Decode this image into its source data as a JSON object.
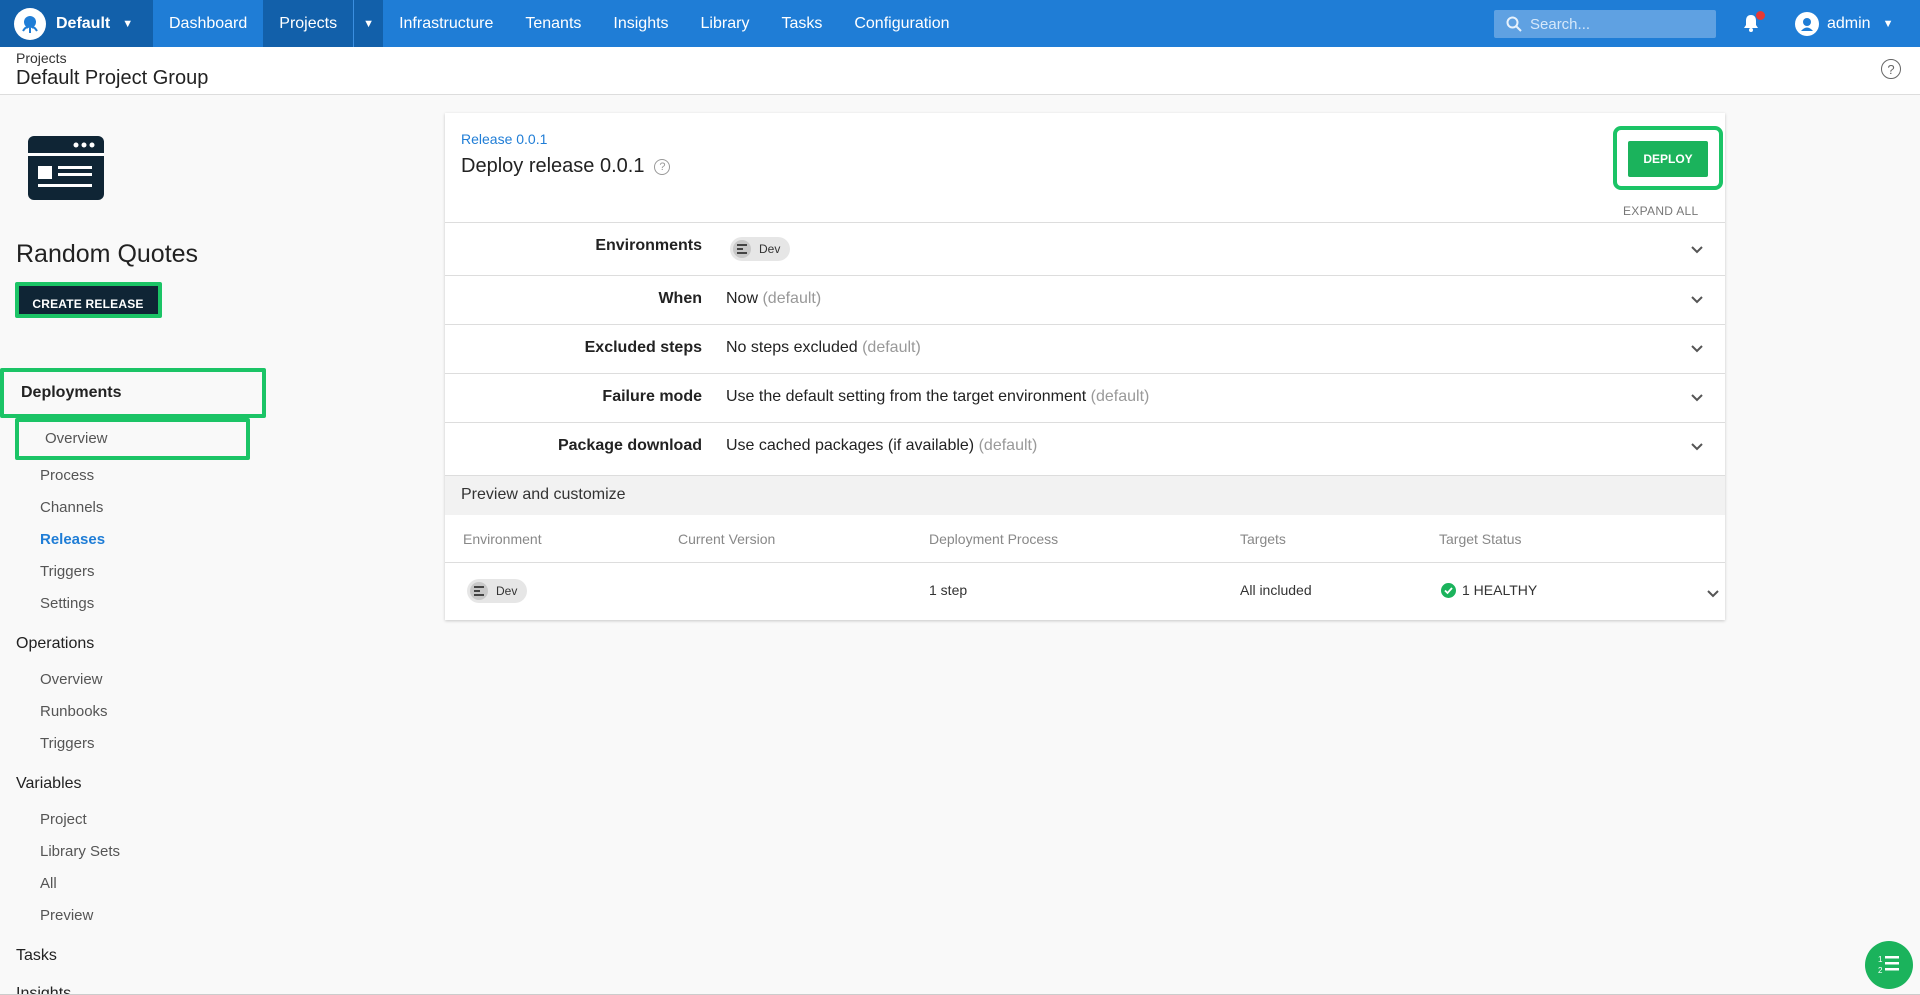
{
  "topnav": {
    "space_name": "Default",
    "items": [
      "Dashboard",
      "Projects",
      "Infrastructure",
      "Tenants",
      "Insights",
      "Library",
      "Tasks",
      "Configuration"
    ],
    "search_placeholder": "Search...",
    "user_name": "admin"
  },
  "header": {
    "breadcrumb": "Projects",
    "title": "Default Project Group"
  },
  "sidebar": {
    "project_name": "Random Quotes",
    "create_release_label": "CREATE RELEASE",
    "deployments": {
      "heading": "Deployments",
      "items": [
        "Overview",
        "Process",
        "Channels",
        "Releases",
        "Triggers",
        "Settings"
      ]
    },
    "operations": {
      "heading": "Operations",
      "items": [
        "Overview",
        "Runbooks",
        "Triggers"
      ]
    },
    "variables": {
      "heading": "Variables",
      "items": [
        "Project",
        "Library Sets",
        "All",
        "Preview"
      ]
    },
    "tasks_heading": "Tasks",
    "insights_heading": "Insights"
  },
  "deploy": {
    "release_link": "Release 0.0.1",
    "title": "Deploy release 0.0.1",
    "deploy_label": "DEPLOY",
    "expand_all_label": "EXPAND ALL",
    "rows": [
      {
        "label": "Environments",
        "chip": "Dev"
      },
      {
        "label": "When",
        "value": "Now",
        "default": "(default)"
      },
      {
        "label": "Excluded steps",
        "value": "No steps excluded",
        "default": "(default)"
      },
      {
        "label": "Failure mode",
        "value": "Use the default setting from the target environment",
        "default": "(default)"
      },
      {
        "label": "Package download",
        "value": "Use cached packages (if available)",
        "default": "(default)"
      }
    ],
    "preview": {
      "title": "Preview and customize",
      "columns": [
        "Environment",
        "Current Version",
        "Deployment Process",
        "Targets",
        "Target Status"
      ],
      "row": {
        "environment": "Dev",
        "current_version": "",
        "deployment_process": "1 step",
        "targets": "All included",
        "target_status": "1 HEALTHY"
      }
    }
  },
  "colors": {
    "nav_blue": "#1f7dd6",
    "nav_active": "#1260aa",
    "highlight_green": "#1bc466",
    "deploy_green": "#1bb35c",
    "dark_navy": "#0f2535"
  }
}
